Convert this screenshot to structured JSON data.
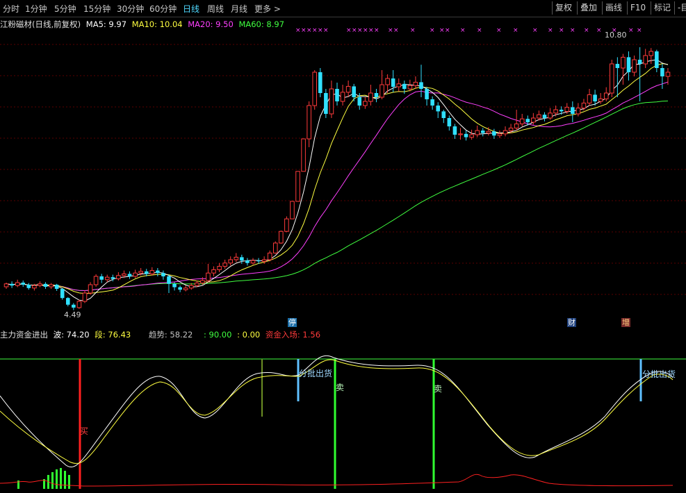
{
  "toolbar": {
    "periods": [
      "分时",
      "1分钟",
      "5分钟",
      "15分钟",
      "30分钟",
      "60分钟",
      "日线",
      "周线",
      "月线",
      "更多 >"
    ],
    "active_period": "日线",
    "buttons": [
      "复权",
      "叠加",
      "画线",
      "F10",
      "标记",
      "-目"
    ]
  },
  "stock_info": {
    "name": "江粉磁材(日线,前复权)",
    "ma5": "MA5: 9.97",
    "ma10": "MA10: 10.04",
    "ma20": "MA20: 9.50",
    "ma60": "MA60: 8.97"
  },
  "price_labels": {
    "high": "10.80",
    "low": "4.49"
  },
  "markers": {
    "halt": "停",
    "finance": "财",
    "increase": "增"
  },
  "indicator_info": {
    "name": "主力资金进出",
    "wave": "波: 74.20",
    "segment": "段: 76.43",
    "trend": "趋势: 58.22",
    "line90": ": 90.00",
    "line0": ": 0.00",
    "inflow": "资金入场: 1.56"
  },
  "signals": {
    "buy": "买",
    "sell1": "卖",
    "sell2": "卖",
    "batch1": "分批出货",
    "batch2": "分批出货"
  },
  "colors": {
    "background": "#000000",
    "up": "#ff3b3b",
    "down": "#30e0ff",
    "ma5": "#ffffff",
    "ma10": "#ffff40",
    "ma20": "#ff40ff",
    "ma60": "#40ff40"
  },
  "chart_data": {
    "type": "candlestick",
    "ylim": [
      4.2,
      11.2
    ],
    "candles": [
      [
        5.05,
        5.12,
        5.15,
        5.0
      ],
      [
        5.12,
        5.08,
        5.18,
        5.02
      ],
      [
        5.08,
        5.15,
        5.22,
        5.04
      ],
      [
        5.15,
        5.1,
        5.2,
        5.05
      ],
      [
        5.1,
        5.02,
        5.14,
        4.98
      ],
      [
        5.02,
        5.08,
        5.12,
        4.96
      ],
      [
        5.08,
        5.12,
        5.18,
        5.04
      ],
      [
        5.12,
        5.05,
        5.16,
        5.0
      ],
      [
        5.05,
        5.1,
        5.14,
        5.0
      ],
      [
        5.1,
        5.0,
        5.12,
        4.95
      ],
      [
        5.0,
        4.78,
        5.02,
        4.74
      ],
      [
        4.78,
        4.62,
        4.8,
        4.58
      ],
      [
        4.62,
        4.55,
        4.66,
        4.49
      ],
      [
        4.55,
        4.7,
        4.74,
        4.52
      ],
      [
        4.7,
        4.9,
        4.96,
        4.66
      ],
      [
        4.9,
        5.1,
        5.16,
        4.86
      ],
      [
        5.1,
        5.3,
        5.35,
        5.05
      ],
      [
        5.3,
        5.22,
        5.36,
        5.14
      ],
      [
        5.22,
        5.28,
        5.34,
        5.16
      ],
      [
        5.28,
        5.24,
        5.34,
        5.18
      ],
      [
        5.24,
        5.32,
        5.4,
        5.2
      ],
      [
        5.32,
        5.36,
        5.44,
        5.26
      ],
      [
        5.36,
        5.3,
        5.42,
        5.24
      ],
      [
        5.3,
        5.38,
        5.46,
        5.26
      ],
      [
        5.38,
        5.42,
        5.5,
        5.32
      ],
      [
        5.42,
        5.36,
        5.48,
        5.3
      ],
      [
        5.36,
        5.44,
        5.52,
        5.32
      ],
      [
        5.44,
        5.38,
        5.5,
        5.3
      ],
      [
        5.38,
        5.3,
        5.44,
        5.22
      ],
      [
        5.3,
        5.12,
        5.34,
        4.9
      ],
      [
        5.12,
        5.04,
        5.16,
        4.96
      ],
      [
        5.04,
        4.98,
        5.08,
        4.92
      ],
      [
        4.98,
        5.02,
        5.08,
        4.94
      ],
      [
        5.02,
        5.08,
        5.14,
        4.98
      ],
      [
        5.08,
        5.14,
        5.2,
        5.04
      ],
      [
        5.14,
        5.2,
        5.28,
        5.1
      ],
      [
        5.2,
        5.38,
        5.6,
        5.16
      ],
      [
        5.38,
        5.46,
        5.54,
        5.3
      ],
      [
        5.46,
        5.54,
        5.62,
        5.4
      ],
      [
        5.54,
        5.62,
        5.7,
        5.48
      ],
      [
        5.62,
        5.7,
        5.78,
        5.56
      ],
      [
        5.7,
        5.76,
        5.86,
        5.64
      ],
      [
        5.76,
        5.68,
        5.82,
        5.6
      ],
      [
        5.68,
        5.62,
        5.74,
        5.56
      ],
      [
        5.62,
        5.68,
        5.74,
        5.58
      ],
      [
        5.68,
        5.66,
        5.74,
        5.6
      ],
      [
        5.66,
        5.7,
        5.78,
        5.6
      ],
      [
        5.7,
        5.86,
        5.92,
        5.66
      ],
      [
        5.86,
        6.1,
        6.14,
        5.84
      ],
      [
        6.1,
        6.38,
        6.4,
        6.08
      ],
      [
        6.38,
        6.68,
        6.74,
        6.36
      ],
      [
        6.68,
        7.1,
        7.1,
        7.02
      ],
      [
        7.1,
        7.82,
        7.82,
        7.76
      ],
      [
        7.82,
        8.6,
        8.6,
        8.6
      ],
      [
        8.6,
        9.4,
        9.5,
        8.4
      ],
      [
        9.4,
        10.2,
        10.25,
        9.3
      ],
      [
        10.2,
        9.7,
        10.3,
        9.6
      ],
      [
        9.7,
        9.2,
        9.8,
        9.1
      ],
      [
        9.2,
        9.8,
        10.0,
        9.1
      ],
      [
        9.8,
        9.5,
        9.95,
        9.4
      ],
      [
        9.5,
        9.72,
        9.9,
        9.4
      ],
      [
        9.72,
        9.86,
        10.0,
        9.6
      ],
      [
        9.86,
        9.6,
        9.92,
        9.5
      ],
      [
        9.6,
        9.4,
        9.7,
        9.3
      ],
      [
        9.4,
        9.5,
        9.6,
        9.32
      ],
      [
        9.5,
        9.7,
        9.9,
        9.4
      ],
      [
        9.7,
        9.6,
        9.8,
        9.48
      ],
      [
        9.6,
        9.9,
        10.25,
        9.55
      ],
      [
        9.9,
        10.05,
        10.15,
        9.7
      ],
      [
        10.05,
        9.85,
        10.25,
        9.72
      ],
      [
        9.85,
        9.92,
        10.05,
        9.74
      ],
      [
        9.92,
        9.8,
        10.0,
        9.68
      ],
      [
        9.8,
        9.88,
        10.02,
        9.74
      ],
      [
        9.88,
        9.96,
        10.1,
        9.8
      ],
      [
        9.96,
        9.8,
        10.38,
        9.6
      ],
      [
        9.8,
        9.55,
        9.85,
        9.4
      ],
      [
        9.55,
        9.4,
        9.62,
        9.3
      ],
      [
        9.4,
        9.26,
        9.48,
        9.1
      ],
      [
        9.26,
        9.1,
        9.3,
        8.98
      ],
      [
        9.1,
        8.9,
        9.16,
        8.8
      ],
      [
        8.9,
        8.7,
        8.96,
        8.6
      ],
      [
        8.7,
        8.72,
        8.86,
        8.58
      ],
      [
        8.72,
        8.64,
        8.8,
        8.56
      ],
      [
        8.64,
        8.7,
        8.82,
        8.58
      ],
      [
        8.7,
        8.8,
        8.92,
        8.64
      ],
      [
        8.8,
        8.74,
        8.86,
        8.66
      ],
      [
        8.74,
        8.78,
        8.88,
        8.68
      ],
      [
        8.78,
        8.68,
        8.84,
        8.6
      ],
      [
        8.68,
        8.72,
        8.8,
        8.62
      ],
      [
        8.72,
        8.8,
        8.9,
        8.66
      ],
      [
        8.8,
        8.86,
        8.96,
        8.74
      ],
      [
        8.86,
        8.96,
        9.3,
        8.8
      ],
      [
        8.96,
        9.08,
        9.2,
        8.9
      ],
      [
        9.08,
        9.0,
        9.16,
        8.92
      ],
      [
        9.0,
        9.1,
        9.22,
        8.94
      ],
      [
        9.1,
        9.18,
        9.28,
        9.04
      ],
      [
        9.18,
        9.1,
        9.24,
        9.02
      ],
      [
        9.1,
        9.22,
        9.34,
        9.06
      ],
      [
        9.22,
        9.3,
        9.4,
        9.14
      ],
      [
        9.3,
        9.26,
        9.38,
        9.18
      ],
      [
        9.26,
        9.36,
        9.46,
        9.2
      ],
      [
        9.36,
        9.2,
        9.5,
        9.0
      ],
      [
        9.2,
        9.34,
        9.46,
        9.14
      ],
      [
        9.34,
        9.46,
        9.56,
        9.28
      ],
      [
        9.46,
        9.66,
        9.8,
        9.4
      ],
      [
        9.66,
        9.5,
        9.78,
        9.4
      ],
      [
        9.5,
        9.56,
        9.7,
        9.44
      ],
      [
        9.56,
        9.7,
        9.84,
        9.5
      ],
      [
        9.7,
        10.4,
        10.5,
        9.6
      ],
      [
        10.4,
        10.3,
        10.56,
        9.6
      ],
      [
        10.3,
        10.56,
        10.64,
        9.9
      ],
      [
        10.56,
        10.2,
        10.7,
        10.0
      ],
      [
        10.2,
        10.5,
        10.6,
        10.1
      ],
      [
        10.5,
        10.4,
        10.8,
        9.5
      ],
      [
        10.4,
        10.6,
        10.76,
        10.3
      ],
      [
        10.6,
        10.7,
        10.78,
        10.4
      ],
      [
        10.7,
        10.3,
        10.74,
        10.2
      ],
      [
        10.3,
        10.1,
        10.4,
        9.8
      ],
      [
        10.1,
        10.2,
        10.3,
        9.9
      ]
    ],
    "ma_series": [
      "MA5",
      "MA10",
      "MA20",
      "MA60"
    ]
  }
}
